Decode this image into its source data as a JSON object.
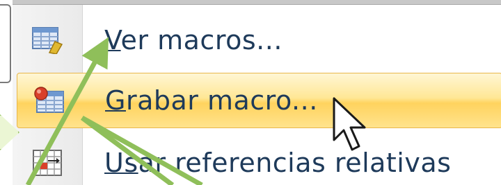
{
  "menu": {
    "items": [
      {
        "underline": "V",
        "rest": "er macros...",
        "icon": "view-macros-icon",
        "highlighted": false
      },
      {
        "underline": "G",
        "rest": "rabar macro...",
        "icon": "record-macro-icon",
        "highlighted": true
      },
      {
        "underline": "Us",
        "rest": "ar referencias relativas",
        "icon": "relative-references-icon",
        "highlighted": false
      }
    ]
  },
  "colors": {
    "highlight": "#ffd35e",
    "arrow": "#8fbf5a",
    "label_text": "#1e3a5a"
  }
}
